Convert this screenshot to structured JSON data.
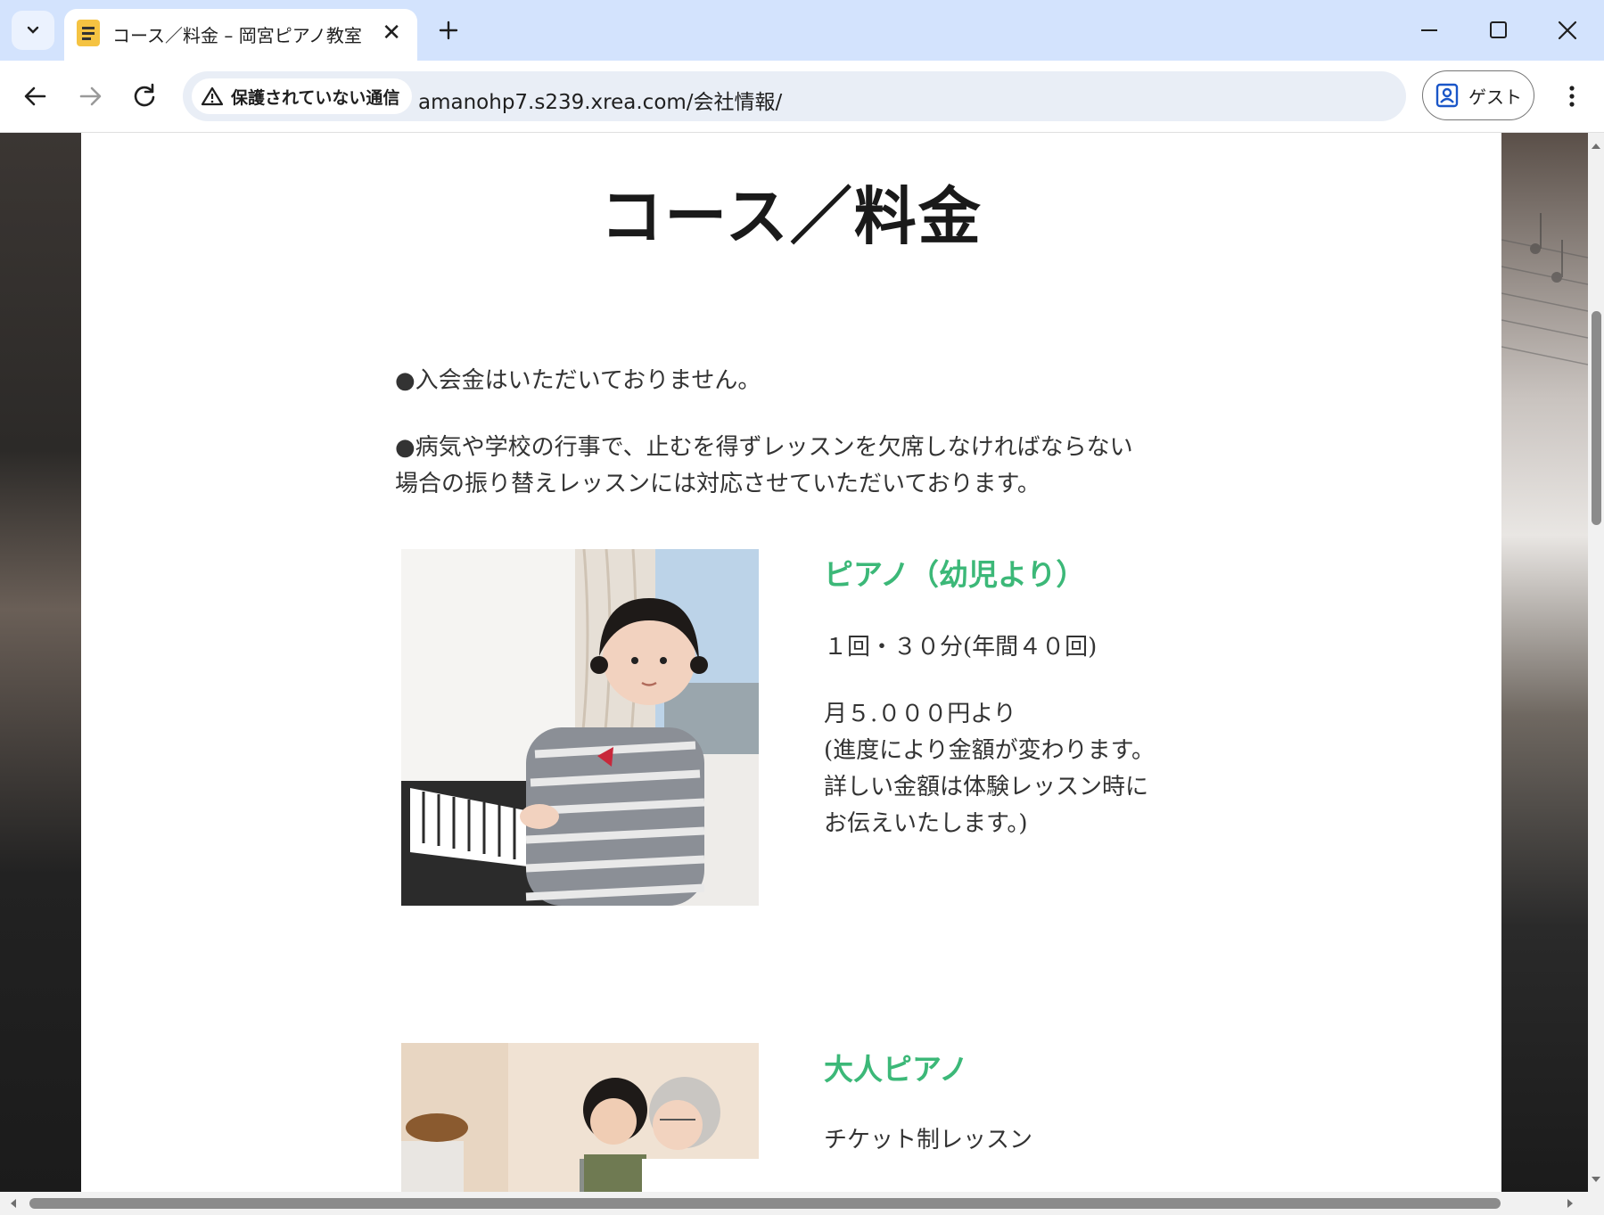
{
  "browser": {
    "tab_title": "コース／料金 – 岡宮ピアノ教室",
    "security_label": "保護されていない通信",
    "url": "amanohp7.s239.xrea.com/会社情報/",
    "profile_label": "ゲスト"
  },
  "page": {
    "title": "コース／料金",
    "notices": [
      "●入会金はいただいておりません。",
      "●病気や学校の行事で、止むを得ずレッスンを欠席しなければならない",
      "場合の振り替えレッスンには対応させていただいております。"
    ],
    "courses": [
      {
        "title": "ピアノ（幼児より）",
        "lines": [
          "１回・３０分(年間４０回)",
          "月５.０００円より",
          "(進度により金額が変わります。",
          "詳しい金額は体験レッスン時に",
          "お伝えいたします。)"
        ]
      },
      {
        "title": "大人ピアノ",
        "lines": [
          "チケット制レッスン"
        ]
      }
    ]
  },
  "colors": {
    "accent_green": "#3cb878",
    "tabbar_bg": "#d3e3fd"
  }
}
